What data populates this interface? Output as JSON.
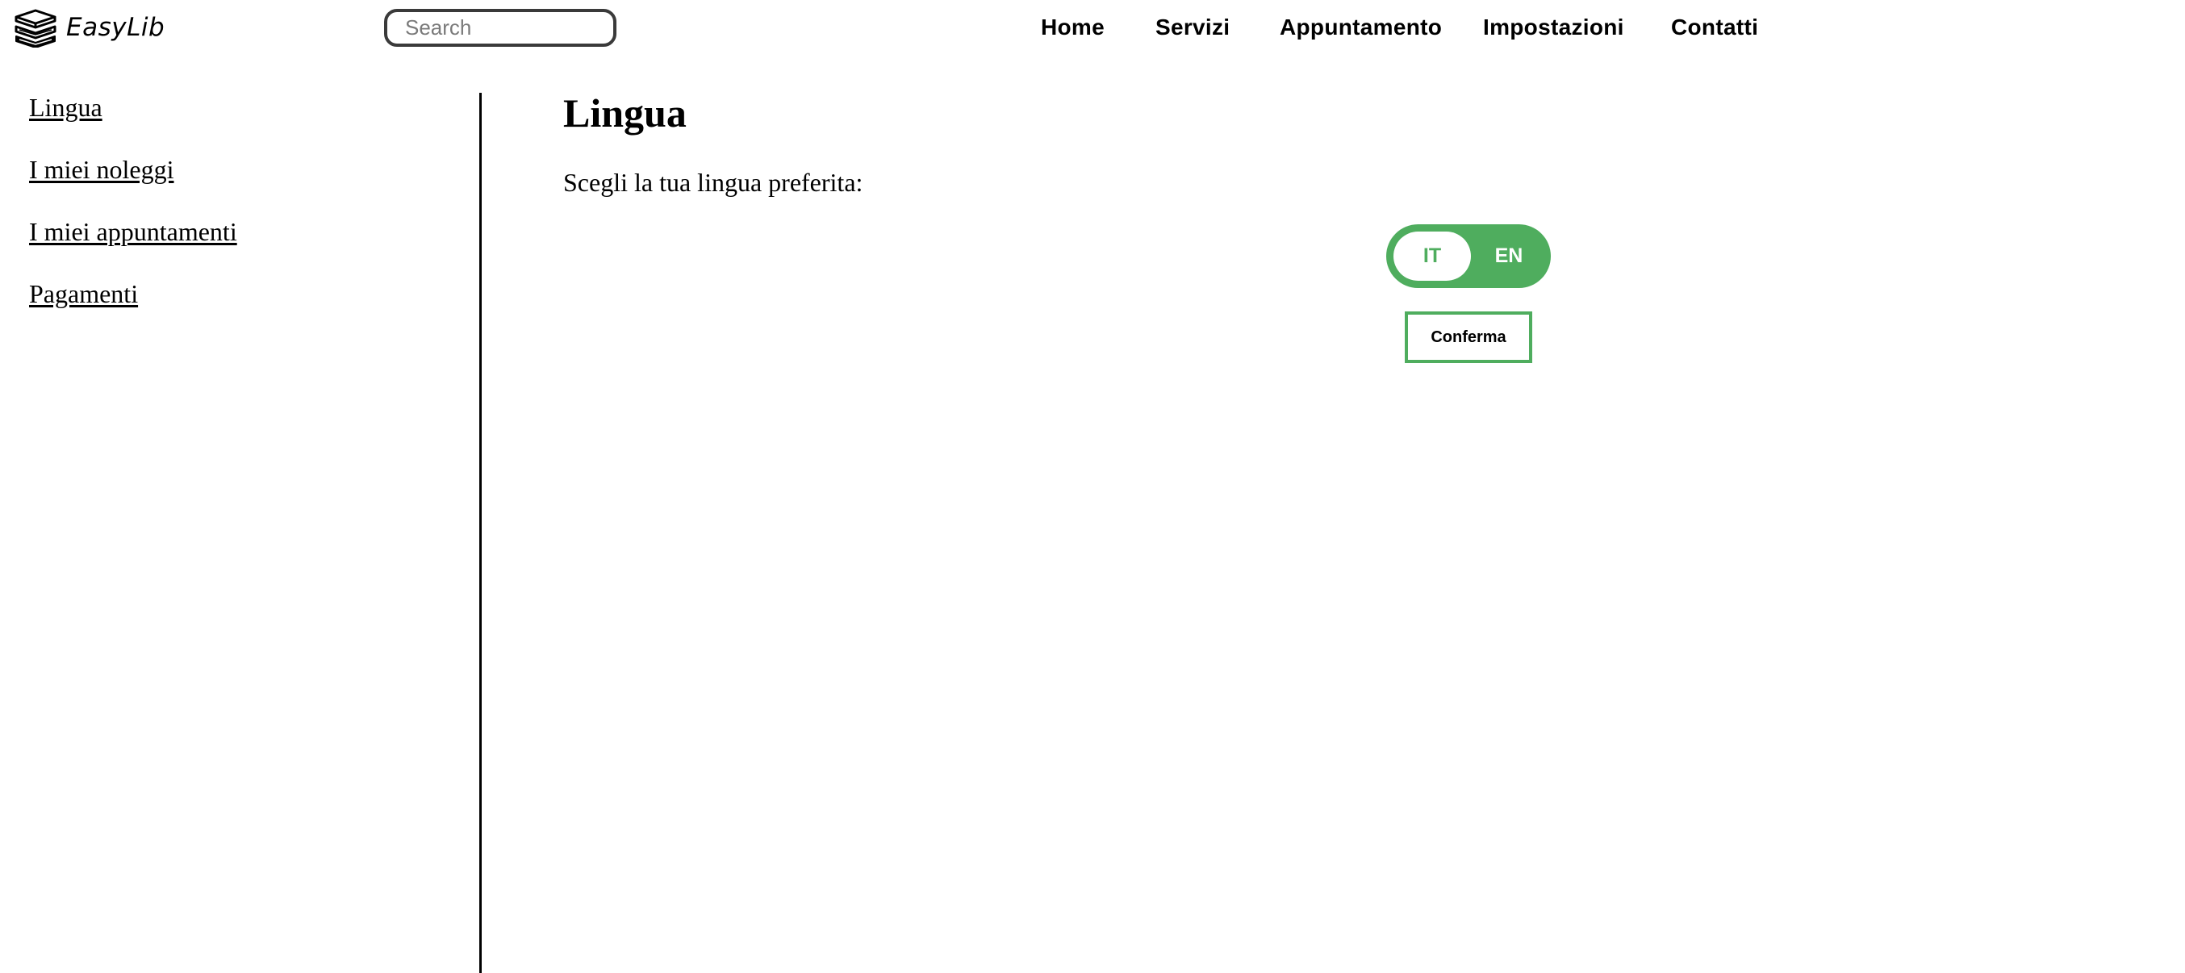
{
  "brand": {
    "name": "EasyLib",
    "icon": "books-stack-icon"
  },
  "search": {
    "placeholder": "Search",
    "value": ""
  },
  "nav": {
    "items": [
      {
        "label": "Home"
      },
      {
        "label": "Servizi"
      },
      {
        "label": "Appuntamento"
      },
      {
        "label": "Impostazioni"
      },
      {
        "label": "Contatti"
      }
    ]
  },
  "sidebar": {
    "items": [
      {
        "label": "Lingua"
      },
      {
        "label": "I miei noleggi"
      },
      {
        "label": "I miei appuntamenti"
      },
      {
        "label": "Pagamenti"
      }
    ]
  },
  "main": {
    "title": "Lingua",
    "prompt": "Scegli la tua lingua preferita:",
    "language_toggle": {
      "options": [
        "IT",
        "EN"
      ],
      "selected": "IT"
    },
    "confirm_label": "Conferma"
  },
  "colors": {
    "accent": "#4fad5e",
    "text": "#000000",
    "background": "#ffffff"
  }
}
